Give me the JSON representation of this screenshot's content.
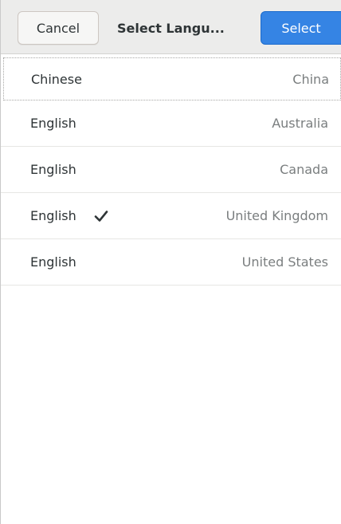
{
  "header": {
    "cancel_label": "Cancel",
    "title": "Select Langu...",
    "select_label": "Select",
    "accent_color": "#3584e4"
  },
  "languages": [
    {
      "language": "Chinese",
      "region": "China",
      "selected": false
    },
    {
      "language": "English",
      "region": "Australia",
      "selected": false
    },
    {
      "language": "English",
      "region": "Canada",
      "selected": false
    },
    {
      "language": "English",
      "region": "United Kingdom",
      "selected": true,
      "icon": "checkmark-icon"
    },
    {
      "language": "English",
      "region": "United States",
      "selected": false
    }
  ]
}
